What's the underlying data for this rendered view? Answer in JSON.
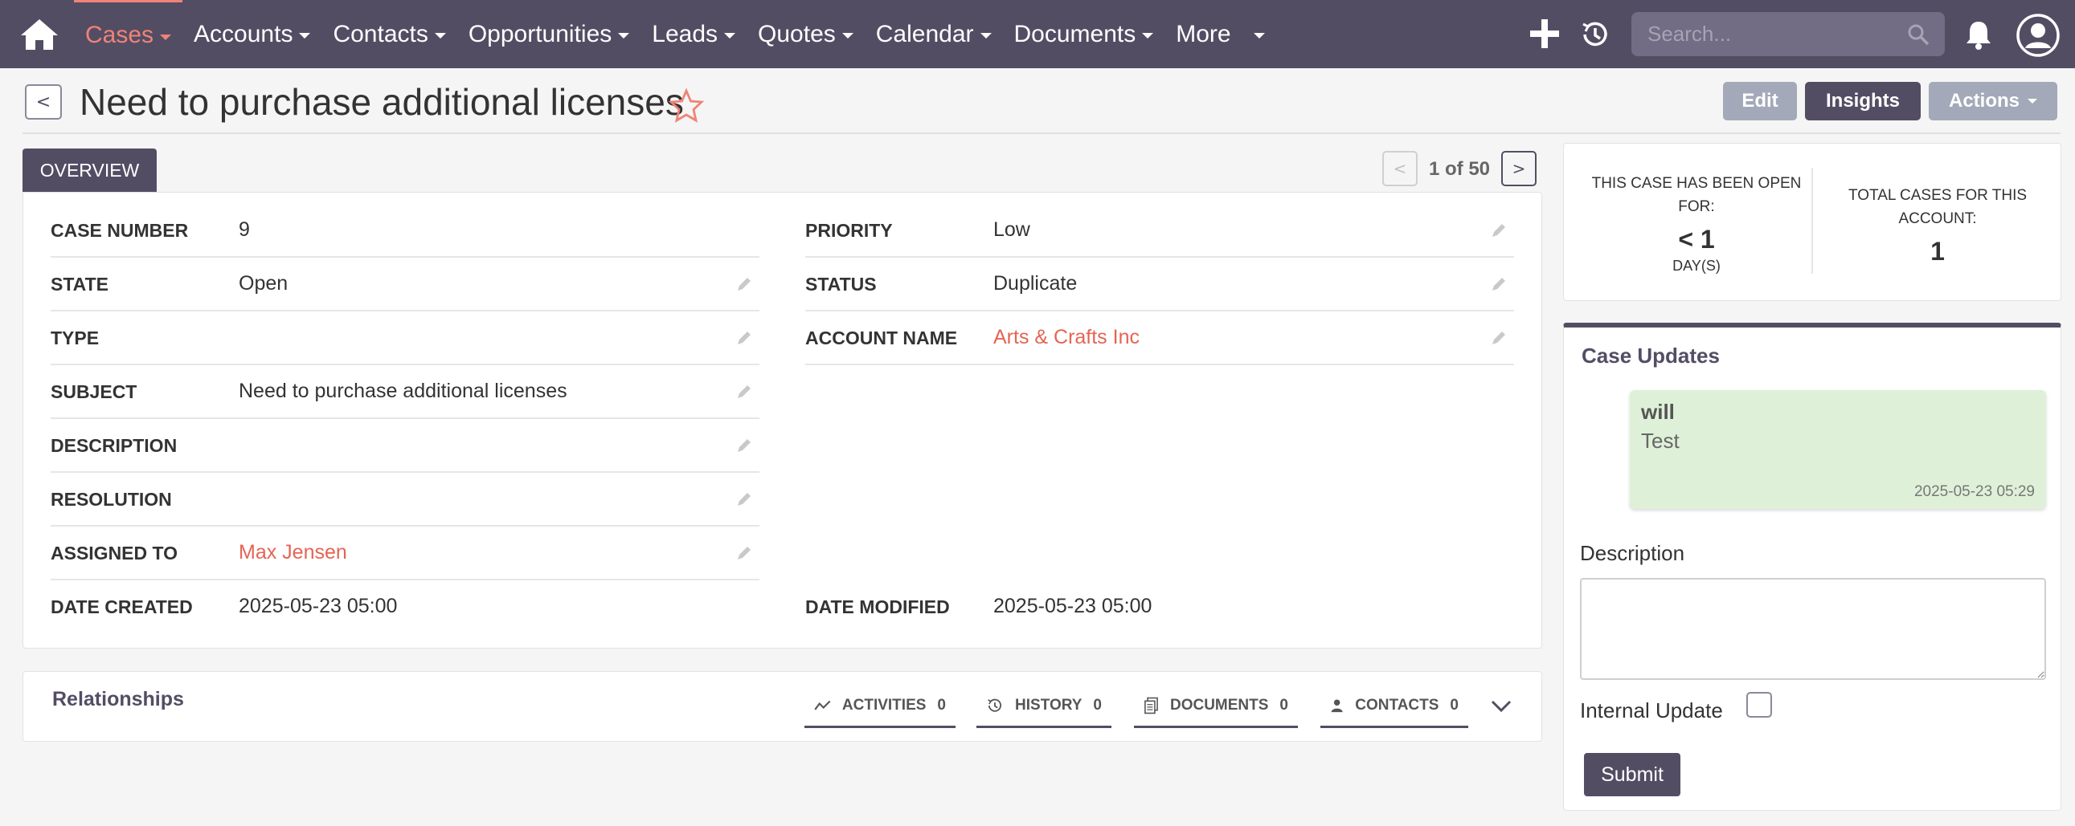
{
  "nav": {
    "items": [
      {
        "label": "Cases",
        "active": true
      },
      {
        "label": "Accounts"
      },
      {
        "label": "Contacts"
      },
      {
        "label": "Opportunities"
      },
      {
        "label": "Leads"
      },
      {
        "label": "Quotes"
      },
      {
        "label": "Calendar"
      },
      {
        "label": "Documents"
      },
      {
        "label": "More"
      }
    ],
    "search_placeholder": "Search...",
    "colors": {
      "bar": "#534d64",
      "active": "#f08377"
    }
  },
  "header": {
    "back_label": "<",
    "title": "Need to purchase additional licenses",
    "buttons": {
      "edit": "Edit",
      "insights": "Insights",
      "actions": "Actions"
    }
  },
  "tabs": {
    "overview": "OVERVIEW"
  },
  "pagination": {
    "prev": "<",
    "text": "1 of 50",
    "next": ">"
  },
  "fields": {
    "case_number": {
      "label": "CASE NUMBER",
      "value": "9"
    },
    "state": {
      "label": "STATE",
      "value": "Open"
    },
    "type": {
      "label": "TYPE",
      "value": ""
    },
    "subject": {
      "label": "SUBJECT",
      "value": "Need to purchase additional licenses"
    },
    "description": {
      "label": "DESCRIPTION",
      "value": ""
    },
    "resolution": {
      "label": "RESOLUTION",
      "value": ""
    },
    "assigned_to": {
      "label": "ASSIGNED TO",
      "value": "Max Jensen"
    },
    "date_created": {
      "label": "DATE CREATED",
      "value": "2025-05-23 05:00"
    },
    "priority": {
      "label": "PRIORITY",
      "value": "Low"
    },
    "status": {
      "label": "STATUS",
      "value": "Duplicate"
    },
    "account_name": {
      "label": "ACCOUNT NAME",
      "value": "Arts & Crafts Inc"
    },
    "date_modified": {
      "label": "DATE MODIFIED",
      "value": "2025-05-23 05:00"
    }
  },
  "relationships": {
    "title": "Relationships",
    "tabs": [
      {
        "label": "ACTIVITIES",
        "count": "0"
      },
      {
        "label": "HISTORY",
        "count": "0"
      },
      {
        "label": "DOCUMENTS",
        "count": "0"
      },
      {
        "label": "CONTACTS",
        "count": "0"
      }
    ]
  },
  "stats": {
    "open_caption": "THIS CASE HAS BEEN OPEN FOR:",
    "open_value": "< 1",
    "open_unit": "DAY(S)",
    "total_caption": "TOTAL CASES FOR THIS ACCOUNT:",
    "total_value": "1"
  },
  "case_updates": {
    "title": "Case Updates",
    "update": {
      "author": "will",
      "text": "Test",
      "time": "2025-05-23 05:29"
    },
    "description_label": "Description",
    "internal_label": "Internal Update",
    "submit_label": "Submit"
  }
}
